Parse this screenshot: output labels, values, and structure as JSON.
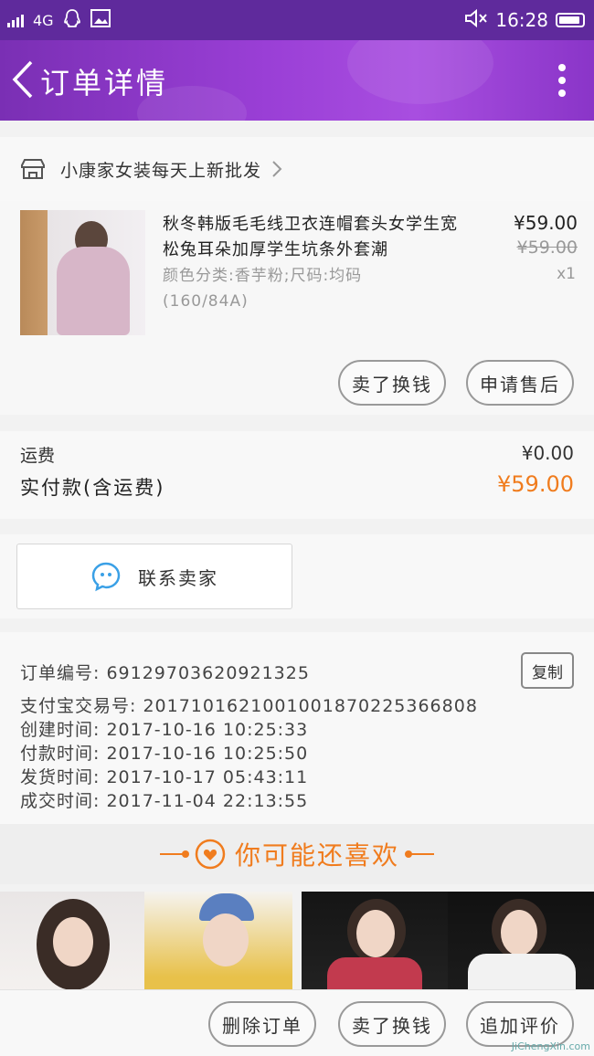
{
  "status_bar": {
    "network": "4G",
    "time": "16:28"
  },
  "header": {
    "title": "订单详情"
  },
  "shop": {
    "name": "小康家女装每天上新批发"
  },
  "item": {
    "title": "秋冬韩版毛毛线卫衣连帽套头女学生宽松兔耳朵加厚学生坑条外套潮",
    "sku": "颜色分类:香芋粉;尺码:均码(160/84A)",
    "price": "¥59.00",
    "original_price": "¥59.00",
    "quantity": "x1",
    "buttons": {
      "exchange": "卖了换钱",
      "after_sale": "申请售后"
    }
  },
  "fees": {
    "shipping_label": "运费",
    "shipping_value": "¥0.00",
    "paid_label": "实付款(含运费)",
    "paid_value": "¥59.00"
  },
  "contact": {
    "label": "联系卖家"
  },
  "order_info": {
    "order_no": "订单编号: 69129703620921325",
    "copy_label": "复制",
    "alipay_no": "支付宝交易号: 2017101621001001870225366808",
    "created": "创建时间: 2017-10-16 10:25:33",
    "paid": "付款时间: 2017-10-16 10:25:50",
    "shipped": "发货时间: 2017-10-17 05:43:11",
    "completed": "成交时间: 2017-11-04 22:13:55"
  },
  "recommend": {
    "title": "你可能还喜欢"
  },
  "bottom_bar": {
    "delete": "删除订单",
    "exchange": "卖了换钱",
    "review": "追加评价"
  },
  "watermark": "JiChengXin.com",
  "colors": {
    "header_purple": "#9a3fd6",
    "accent_orange": "#f07c1e"
  }
}
